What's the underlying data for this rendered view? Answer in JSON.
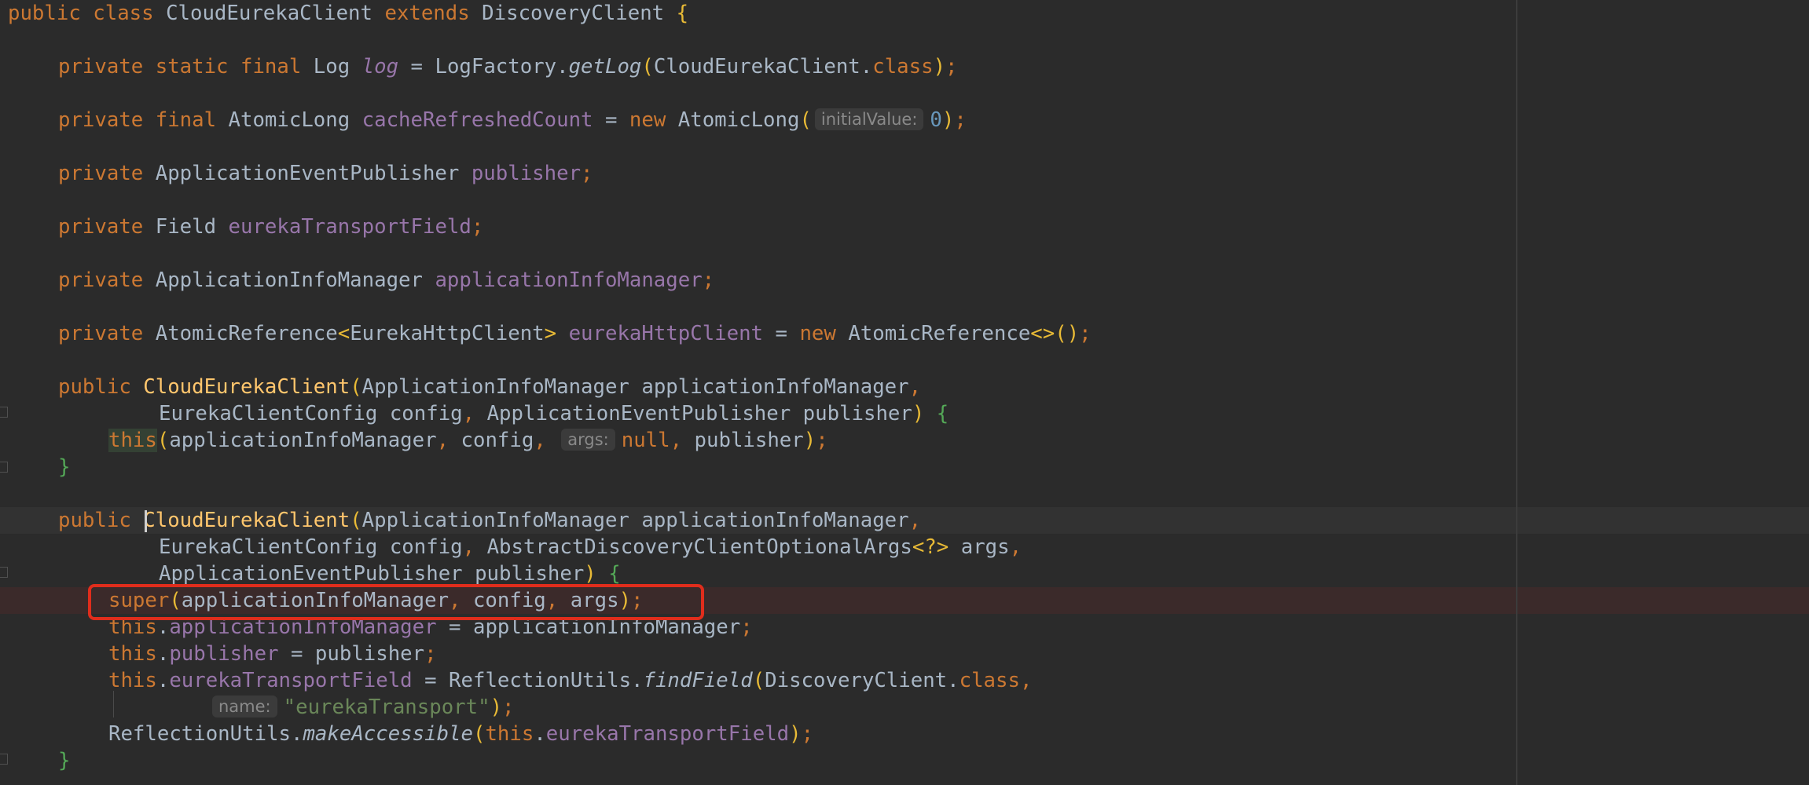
{
  "editor": {
    "lines": [
      [
        [
          "kw",
          "public "
        ],
        [
          "kw",
          "class "
        ],
        [
          "type",
          "CloudEurekaClient "
        ],
        [
          "kw",
          "extends "
        ],
        [
          "type",
          "DiscoveryClient "
        ],
        [
          "brace-yellow",
          "{"
        ]
      ],
      [
        [
          "kw",
          "private "
        ],
        [
          "kw",
          "static "
        ],
        [
          "kw",
          "final "
        ],
        [
          "type",
          "Log "
        ],
        [
          "static-field",
          "log"
        ],
        [
          "plain",
          " = LogFactory."
        ],
        [
          "static-call",
          "getLog"
        ],
        [
          "paren",
          "("
        ],
        [
          "plain",
          "CloudEurekaClient."
        ],
        [
          "kw",
          "class"
        ],
        [
          "paren",
          ")"
        ],
        [
          "punc",
          ";"
        ]
      ],
      [
        [
          "kw",
          "private "
        ],
        [
          "kw",
          "final "
        ],
        [
          "type",
          "AtomicLong "
        ],
        [
          "field",
          "cacheRefreshedCount"
        ],
        [
          "plain",
          " = "
        ],
        [
          "kw",
          "new "
        ],
        [
          "type",
          "AtomicLong"
        ],
        [
          "paren",
          "("
        ],
        [
          "hint",
          "initialValue:"
        ],
        [
          "num",
          "0"
        ],
        [
          "paren",
          ")"
        ],
        [
          "punc",
          ";"
        ]
      ],
      [
        [
          "kw",
          "private "
        ],
        [
          "type",
          "ApplicationEventPublisher "
        ],
        [
          "field",
          "publisher"
        ],
        [
          "punc",
          ";"
        ]
      ],
      [
        [
          "kw",
          "private "
        ],
        [
          "type",
          "Field "
        ],
        [
          "field",
          "eurekaTransportField"
        ],
        [
          "punc",
          ";"
        ]
      ],
      [
        [
          "kw",
          "private "
        ],
        [
          "type",
          "ApplicationInfoManager "
        ],
        [
          "field",
          "applicationInfoManager"
        ],
        [
          "punc",
          ";"
        ]
      ],
      [
        [
          "kw",
          "private "
        ],
        [
          "type",
          "AtomicReference"
        ],
        [
          "paren",
          "<"
        ],
        [
          "type",
          "EurekaHttpClient"
        ],
        [
          "paren",
          "> "
        ],
        [
          "field",
          "eurekaHttpClient"
        ],
        [
          "plain",
          " = "
        ],
        [
          "kw",
          "new "
        ],
        [
          "type",
          "AtomicReference"
        ],
        [
          "paren",
          "<>()"
        ],
        [
          "punc",
          ";"
        ]
      ],
      [
        [
          "kw",
          "public "
        ],
        [
          "method-decl",
          "CloudEurekaClient"
        ],
        [
          "paren",
          "("
        ],
        [
          "type",
          "ApplicationInfoManager applicationInfoManager"
        ],
        [
          "punc",
          ","
        ]
      ],
      [
        [
          "type",
          "EurekaClientConfig config"
        ],
        [
          "punc",
          ", "
        ],
        [
          "type",
          "ApplicationEventPublisher publisher"
        ],
        [
          "paren",
          ") "
        ],
        [
          "brace-green",
          "{"
        ]
      ],
      [
        [
          "kw this-hl",
          "this"
        ],
        [
          "paren",
          "("
        ],
        [
          "plain",
          "applicationInfoManager"
        ],
        [
          "punc",
          ", "
        ],
        [
          "plain",
          "config"
        ],
        [
          "punc",
          ", "
        ],
        [
          "hint",
          "args:"
        ],
        [
          "kw",
          "null"
        ],
        [
          "punc",
          ", "
        ],
        [
          "plain",
          "publisher"
        ],
        [
          "paren",
          ")"
        ],
        [
          "punc",
          ";"
        ]
      ],
      [
        [
          "brace-green",
          "}"
        ]
      ],
      [
        [
          "kw",
          "public "
        ],
        [
          "method-decl",
          "CloudEurekaClient"
        ],
        [
          "paren",
          "("
        ],
        [
          "type",
          "ApplicationInfoManager applicationInfoManager"
        ],
        [
          "punc",
          ","
        ]
      ],
      [
        [
          "type",
          "EurekaClientConfig config"
        ],
        [
          "punc",
          ", "
        ],
        [
          "type",
          "AbstractDiscoveryClientOptionalArgs"
        ],
        [
          "paren",
          "<?> "
        ],
        [
          "plain",
          "args"
        ],
        [
          "punc",
          ","
        ]
      ],
      [
        [
          "type",
          "ApplicationEventPublisher publisher"
        ],
        [
          "paren",
          ") "
        ],
        [
          "brace-green",
          "{"
        ]
      ],
      [
        [
          "kw",
          "super"
        ],
        [
          "paren",
          "("
        ],
        [
          "plain",
          "applicationInfoManager"
        ],
        [
          "punc",
          ", "
        ],
        [
          "plain",
          "config"
        ],
        [
          "punc",
          ", "
        ],
        [
          "plain",
          "args"
        ],
        [
          "paren",
          ")"
        ],
        [
          "punc",
          ";"
        ]
      ],
      [
        [
          "kw",
          "this"
        ],
        [
          "plain",
          "."
        ],
        [
          "field",
          "applicationInfoManager"
        ],
        [
          "plain",
          " = applicationInfoManager"
        ],
        [
          "punc",
          ";"
        ]
      ],
      [
        [
          "kw",
          "this"
        ],
        [
          "plain",
          "."
        ],
        [
          "field",
          "publisher"
        ],
        [
          "plain",
          " = publisher"
        ],
        [
          "punc",
          ";"
        ]
      ],
      [
        [
          "kw",
          "this"
        ],
        [
          "plain",
          "."
        ],
        [
          "field",
          "eurekaTransportField"
        ],
        [
          "plain",
          " = ReflectionUtils."
        ],
        [
          "static-call",
          "findField"
        ],
        [
          "paren",
          "("
        ],
        [
          "plain",
          "DiscoveryClient."
        ],
        [
          "kw",
          "class"
        ],
        [
          "punc",
          ","
        ]
      ],
      [
        [
          "hint",
          "name:"
        ],
        [
          "str",
          "\"eurekaTransport\""
        ],
        [
          "paren",
          ")"
        ],
        [
          "punc",
          ";"
        ]
      ],
      [
        [
          "plain",
          "ReflectionUtils."
        ],
        [
          "static-call",
          "makeAccessible"
        ],
        [
          "paren",
          "("
        ],
        [
          "kw",
          "this"
        ],
        [
          "plain",
          "."
        ],
        [
          "field",
          "eurekaTransportField"
        ],
        [
          "paren",
          ")"
        ],
        [
          "punc",
          ";"
        ]
      ],
      [
        [
          "brace-green",
          "}"
        ]
      ]
    ]
  }
}
